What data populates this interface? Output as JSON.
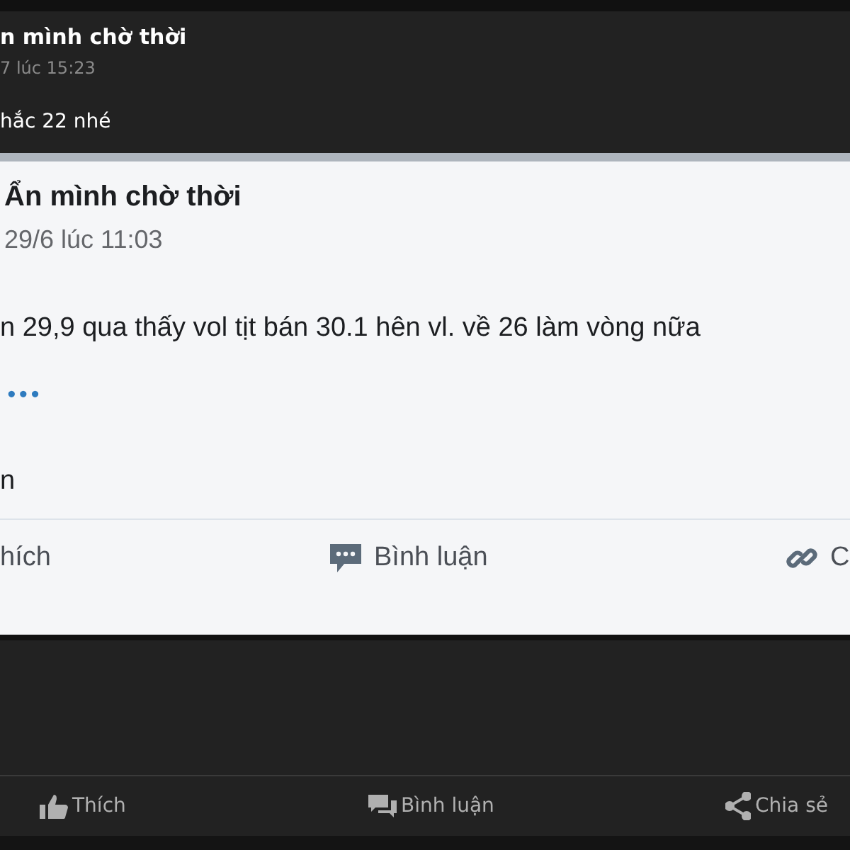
{
  "post": {
    "author": "n mình chờ thời",
    "time": "7 lúc 15:23",
    "text": "hắc 22 nhé"
  },
  "shared_screenshot": {
    "author": "Ẩn mình chờ thời",
    "time": "29/6 lúc 11:03",
    "text": "n 29,9 qua thấy vol tịt bán 30.1 hên vl. về 26 làm vòng nữa",
    "more": "•••",
    "line_2": "n",
    "actions": [
      {
        "kind": "like",
        "label": "hích"
      },
      {
        "kind": "comment",
        "label": "Bình luận"
      },
      {
        "kind": "link",
        "label": "C"
      }
    ]
  },
  "actions": [
    {
      "kind": "like",
      "label": "Thích"
    },
    {
      "kind": "comment",
      "label": "Bình luận"
    },
    {
      "kind": "share",
      "label": "Chia sẻ"
    }
  ]
}
